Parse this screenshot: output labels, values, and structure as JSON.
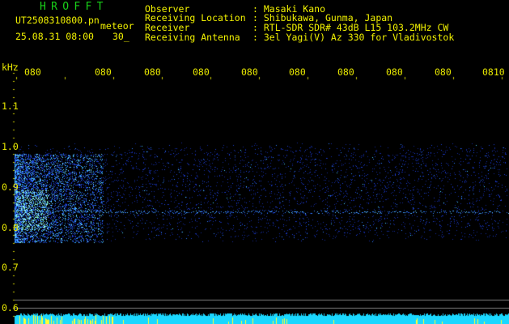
{
  "header": {
    "title": "HROFFT",
    "filename": "UT2508310800.pn",
    "mode": "meteor",
    "datetime": "25.08.31 08:00",
    "value": "30_"
  },
  "station": {
    "observer_label": "Observer",
    "observer_value": ": Masaki Kano",
    "location_label": "Receiving Location",
    "location_value": ": Shibukawa, Gunma, Japan",
    "receiver_label": "Receiver",
    "receiver_value": ": RTL-SDR SDR# 43dB L15 103.2MHz CW",
    "antenna_label": "Receiving Antenna",
    "antenna_value": ": 3el Yagi(V) Az 330 for Vladivostok"
  },
  "y_axis": {
    "unit": "kHz",
    "ticks": [
      "1.1",
      "1.0",
      "0.9",
      "0.8",
      "0.7",
      "0.6"
    ]
  },
  "x_axis": {
    "ticks": [
      "080",
      "080",
      "080",
      "080",
      "080",
      "080",
      "080",
      "080",
      "080",
      "0810"
    ]
  },
  "colors": {
    "background": "#000000",
    "text": "#f2f200",
    "title": "#19d119",
    "spectrum": "#1a33ff",
    "bottom_bar": "#1ad7ff",
    "ticks": "#e8e800"
  }
}
